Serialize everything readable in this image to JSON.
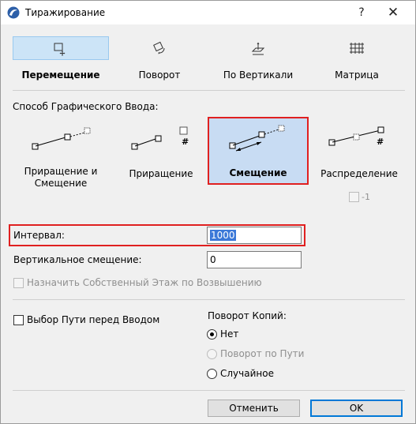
{
  "window": {
    "title": "Тиражирование",
    "help_glyph": "?",
    "close_glyph": "✕"
  },
  "modes": [
    {
      "label": "Перемещение",
      "icon": "move-icon",
      "selected": true
    },
    {
      "label": "Поворот",
      "icon": "rotate-icon",
      "selected": false
    },
    {
      "label": "По Вертикали",
      "icon": "elevate-icon",
      "selected": false
    },
    {
      "label": "Матрица",
      "icon": "matrix-icon",
      "selected": false
    }
  ],
  "input_method": {
    "label": "Способ Графического Ввода:",
    "options": [
      {
        "label_line1": "Приращение и",
        "label_line2": "Смещение",
        "icon": "increment-and-offset-icon",
        "selected": false
      },
      {
        "label_line1": "Приращение",
        "label_line2": "",
        "icon": "increment-icon",
        "selected": false
      },
      {
        "label_line1": "Смещение",
        "label_line2": "",
        "icon": "offset-icon",
        "selected": true
      },
      {
        "label_line1": "Распределение",
        "label_line2": "",
        "icon": "distribute-icon",
        "selected": false
      }
    ],
    "distribute_minus_one_label": "-1"
  },
  "fields": {
    "interval_label": "Интервал:",
    "interval_value": "1000",
    "vertical_offset_label": "Вертикальное смещение:",
    "vertical_offset_value": "0",
    "assign_story_label": "Назначить Собственный Этаж по Возвышению"
  },
  "path": {
    "select_path_label": "Выбор Пути перед Вводом"
  },
  "rotation": {
    "label": "Поворот Копий:",
    "options": [
      {
        "label": "Нет",
        "checked": true,
        "enabled": true
      },
      {
        "label": "Поворот по Пути",
        "checked": false,
        "enabled": false
      },
      {
        "label": "Случайное",
        "checked": false,
        "enabled": true
      }
    ]
  },
  "buttons": {
    "cancel": "Отменить",
    "ok": "OK"
  },
  "colors": {
    "selection_blue": "#cce4f7",
    "highlight_red": "#e02020",
    "text_selection": "#3b78d8"
  }
}
